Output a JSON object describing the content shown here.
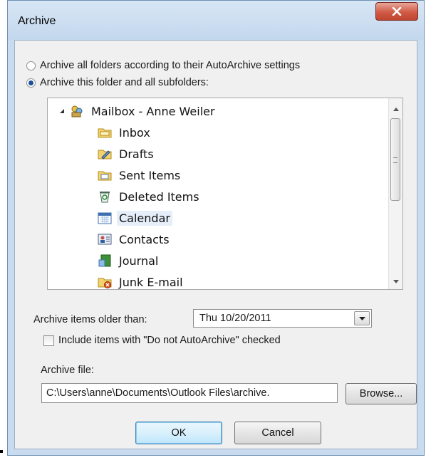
{
  "window": {
    "title": "Archive",
    "close_glyph": "x"
  },
  "options": {
    "archive_all_label": "Archive all folders according to their AutoArchive settings",
    "archive_this_label": "Archive this folder and all subfolders:",
    "selected": "archive_this"
  },
  "tree": {
    "root": {
      "label": "Mailbox - Anne Weiler",
      "icon": "mailbox-icon",
      "expanded": true
    },
    "items": [
      {
        "label": "Inbox",
        "icon": "inbox-folder-icon"
      },
      {
        "label": "Drafts",
        "icon": "drafts-folder-icon"
      },
      {
        "label": "Sent Items",
        "icon": "sent-items-folder-icon"
      },
      {
        "label": "Deleted Items",
        "icon": "deleted-items-icon"
      },
      {
        "label": "Calendar",
        "icon": "calendar-icon",
        "selected": true
      },
      {
        "label": "Contacts",
        "icon": "contacts-icon"
      },
      {
        "label": "Journal",
        "icon": "journal-icon"
      },
      {
        "label": "Junk E-mail",
        "icon": "junk-email-folder-icon"
      }
    ]
  },
  "archive_older": {
    "label": "Archive items older than:",
    "value": "Thu 10/20/2011"
  },
  "include_checkbox": {
    "label": "Include items with \"Do not AutoArchive\" checked",
    "checked": false
  },
  "archive_file": {
    "label": "Archive file:",
    "value": "C:\\Users\\anne\\Documents\\Outlook Files\\archive.",
    "browse_label": "Browse..."
  },
  "buttons": {
    "ok_label": "OK",
    "cancel_label": "Cancel"
  },
  "colors": {
    "selection": "#e5eef9",
    "frame": "#c9dbef",
    "close_button": "#d05a45"
  }
}
